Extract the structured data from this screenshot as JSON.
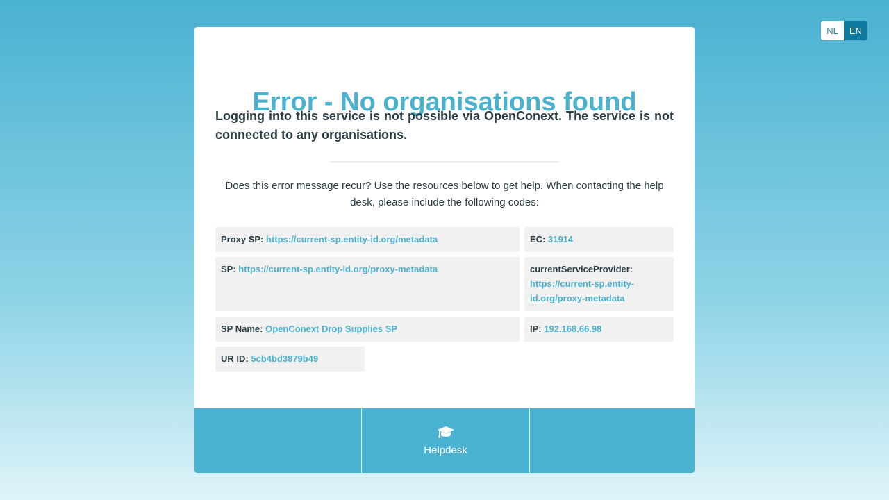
{
  "language_switch": {
    "options": [
      {
        "code": "NL",
        "active": false
      },
      {
        "code": "EN",
        "active": true
      }
    ],
    "active_color": "#0f7aa0"
  },
  "error": {
    "title": "Error - No organisations found",
    "lead": "Logging into this service is not possible via OpenConext. The service is not connected to any organisations.",
    "help_text": "Does this error message recur? Use the resources below to get help. When contacting the help desk, please include the following codes:"
  },
  "codes": {
    "proxy_sp": {
      "label": "Proxy SP:",
      "value": "https://current-sp.entity-id.org/metadata"
    },
    "ec": {
      "label": "EC:",
      "value": "31914"
    },
    "sp": {
      "label": "SP:",
      "value": "https://current-sp.entity-id.org/proxy-metadata"
    },
    "current_service_provider": {
      "label": "currentServiceProvider:",
      "value": "https://current-sp.entity-id.org/proxy-metadata"
    },
    "sp_name": {
      "label": "SP Name:",
      "value": "OpenConext Drop Supplies SP"
    },
    "ip": {
      "label": "IP:",
      "value": "192.168.66.98"
    },
    "ur_id": {
      "label": "UR ID:",
      "value": "5cb4bd3879b49"
    }
  },
  "footer": {
    "helpdesk": {
      "label": "Helpdesk",
      "icon": "graduation-cap-icon"
    }
  },
  "colors": {
    "accent": "#4ab2cf",
    "text": "#2a3d46",
    "code_bg": "#f1f1f1"
  }
}
